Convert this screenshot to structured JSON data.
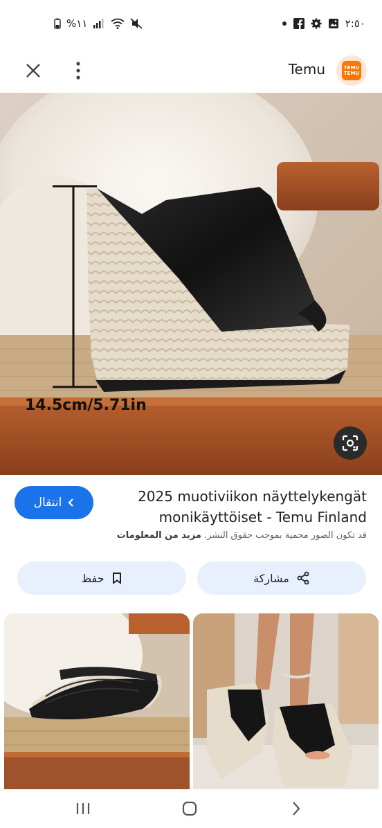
{
  "status_bar": {
    "time": "٢:٥٠",
    "battery": "%١١",
    "icons": [
      "battery-icon",
      "signal-icon",
      "wifi-icon",
      "mute-icon",
      "dot-icon",
      "facebook-icon",
      "settings-icon",
      "gallery-icon"
    ]
  },
  "app_bar": {
    "title": "Temu",
    "logo_top": "TEMU",
    "logo_bottom": "TEMU",
    "close_icon": "close-icon",
    "more_icon": "more-vert-icon"
  },
  "hero": {
    "measurement": "14.5cm/5.71in",
    "lens_icon": "lens-icon"
  },
  "result": {
    "visit_label": "انتقال",
    "title": "2025 muotiviikon näyttelykengät monikäyttöiset - Temu Finland",
    "copyright_text": "قد تكون الصور محمية بموجب حقوق النشر.",
    "copyright_link": "مزيد من المعلومات"
  },
  "actions": {
    "save_label": "حفظ",
    "share_label": "مشاركة"
  },
  "colors": {
    "accent": "#1a73e8",
    "pill_bg": "#e8f0fe",
    "brand": "#fb7701"
  }
}
